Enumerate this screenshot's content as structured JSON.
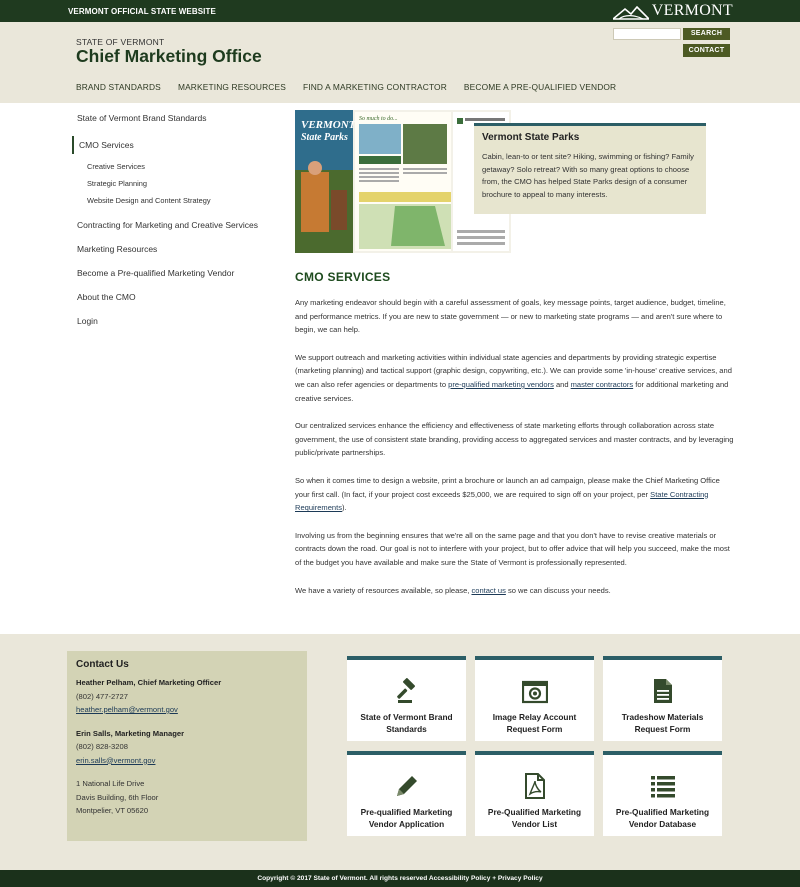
{
  "topbar": {
    "official": "VERMONT OFFICIAL STATE WEBSITE",
    "logo_text": "VERMONT"
  },
  "header": {
    "state": "STATE OF VERMONT",
    "office": "Chief Marketing Office",
    "search_placeholder": "",
    "search_label": "SEARCH",
    "contact_label": "CONTACT"
  },
  "nav": [
    {
      "label": "BRAND STANDARDS"
    },
    {
      "label": "MARKETING RESOURCES"
    },
    {
      "label": "FIND A MARKETING CONTRACTOR"
    },
    {
      "label": "BECOME A PRE-QUALIFIED VENDOR"
    }
  ],
  "sidebar": {
    "brand": "State of Vermont Brand Standards",
    "cmo": "CMO Services",
    "subs": [
      "Creative Services",
      "Strategic Planning",
      "Website Design and Content Strategy"
    ],
    "contracting": "Contracting for Marketing and Creative Services",
    "resources": "Marketing Resources",
    "vendor": "Become a Pre-qualified Marketing Vendor",
    "about": "About the CMO",
    "login": "Login"
  },
  "hero": {
    "brochure_title_1": "VERMONT",
    "brochure_title_2": "State Parks",
    "brochure_tag": "So much to do...",
    "callout_title": "Vermont State Parks",
    "callout_text": "Cabin, lean-to or tent site? Hiking, swimming or fishing? Family getaway? Solo retreat? With so many great options to choose from, the CMO has helped State Parks design of a consumer brochure to appeal to many interests."
  },
  "main": {
    "title": "CMO SERVICES",
    "p1": "Any marketing endeavor should begin with a careful assessment of goals, key message points, target audience, budget, timeline, and performance metrics. If you are new to state government — or new to marketing state programs — and aren't sure where to begin, we can help.",
    "p2_a": "We support outreach and marketing activities within individual state agencies and departments by providing strategic expertise (marketing planning) and tactical support (graphic design, copywriting, etc.). We can provide some 'in-house' creative services, and we can also refer agencies or departments to ",
    "p2_link1": "pre-qualified marketing vendors",
    "p2_b": " and ",
    "p2_link2": "master contractors",
    "p2_c": " for additional marketing and creative services.",
    "p3": "Our centralized services enhance the efficiency and effectiveness of state marketing efforts through collaboration across state government, the use of consistent state branding, providing access to aggregated services and master contracts, and by leveraging public/private partnerships.",
    "p4_a": "So when it comes time to design a website, print a brochure or launch an ad campaign, please make the Chief Marketing Office your first call. (In fact, if your project cost exceeds $25,000, we are required to sign off on your project, per ",
    "p4_link": "State Contracting Requirements",
    "p4_b": ").",
    "p5": "Involving us from the beginning ensures that we're all on the same page and that you don't have to revise creative materials or contracts down the road. Our goal is not to interfere with your project, but to offer advice that will help you succeed, make the most of the budget you have available and make sure the State of Vermont is professionally represented.",
    "p6_a": "We have a variety of resources available, so please, ",
    "p6_link": "contact us",
    "p6_b": " so we can discuss your needs."
  },
  "contact": {
    "title": "Contact Us",
    "person1_name": "Heather Pelham, Chief Marketing Officer",
    "person1_phone": "(802) 477-2727",
    "person1_email": "heather.pelham@vermont.gov",
    "person2_name": "Erin Salls, Marketing Manager",
    "person2_phone": "(802) 828-3208",
    "person2_email": "erin.salls@vermont.gov",
    "addr1": "1 National Life Drive",
    "addr2": "Davis Building, 6th Floor",
    "addr3": "Montpelier, VT 05620"
  },
  "tiles": [
    {
      "label": "State of Vermont Brand Standards",
      "icon": "gavel-icon"
    },
    {
      "label": "Image Relay Account Request Form",
      "icon": "camera-icon"
    },
    {
      "label": "Tradeshow Materials Request Form",
      "icon": "document-icon"
    },
    {
      "label": "Pre-qualified Marketing Vendor Application",
      "icon": "pencil-icon"
    },
    {
      "label": "Pre-Qualified Marketing Vendor List",
      "icon": "pdf-icon"
    },
    {
      "label": "Pre-Qualified Marketing Vendor Database",
      "icon": "list-icon"
    }
  ],
  "footer": {
    "copyright": "Copyright © 2017 State of Vermont. All rights reserved Accessibility Policy + Privacy Policy"
  },
  "colors": {
    "dark_green": "#1f3a1f",
    "olive": "#4d5a23",
    "beige": "#eae7da",
    "teal": "#2c5e66",
    "khaki": "#d3d3b5"
  }
}
